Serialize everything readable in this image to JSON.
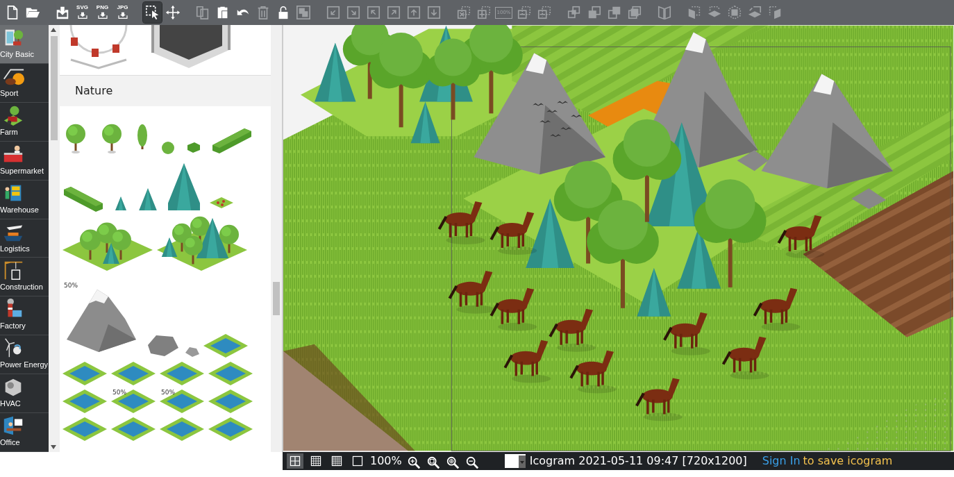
{
  "toolbar": [
    {
      "kind": "new-file",
      "disabled": false,
      "selected": false
    },
    {
      "kind": "open-folder",
      "disabled": false,
      "selected": false
    },
    {
      "kind": "save",
      "disabled": false,
      "selected": false
    },
    {
      "kind": "export",
      "label": "SVG",
      "disabled": false,
      "selected": false
    },
    {
      "kind": "export",
      "label": "PNG",
      "disabled": false,
      "selected": false
    },
    {
      "kind": "export",
      "label": "JPG",
      "disabled": false,
      "selected": false
    },
    {
      "kind": "select",
      "disabled": false,
      "selected": true
    },
    {
      "kind": "move",
      "disabled": false,
      "selected": false
    },
    {
      "kind": "copy",
      "disabled": true,
      "selected": false
    },
    {
      "kind": "paste",
      "disabled": false,
      "selected": false
    },
    {
      "kind": "undo",
      "disabled": false,
      "selected": false
    },
    {
      "kind": "delete",
      "disabled": true,
      "selected": false
    },
    {
      "kind": "lock",
      "disabled": false,
      "selected": false
    },
    {
      "kind": "group",
      "disabled": true,
      "selected": false
    },
    {
      "kind": "arrow-sw",
      "disabled": true,
      "selected": false
    },
    {
      "kind": "arrow-se",
      "disabled": true,
      "selected": false
    },
    {
      "kind": "arrow-nw",
      "disabled": true,
      "selected": false
    },
    {
      "kind": "arrow-ne",
      "disabled": true,
      "selected": false
    },
    {
      "kind": "arrow-up",
      "disabled": true,
      "selected": false
    },
    {
      "kind": "arrow-down",
      "disabled": true,
      "selected": false
    },
    {
      "kind": "dashed-x",
      "disabled": true,
      "selected": false
    },
    {
      "kind": "dashed-plus",
      "disabled": true,
      "selected": false
    },
    {
      "kind": "percent",
      "label": "100%",
      "disabled": true,
      "selected": false
    },
    {
      "kind": "dashed-minus",
      "disabled": true,
      "selected": false
    },
    {
      "kind": "dashed-divide",
      "disabled": true,
      "selected": false
    },
    {
      "kind": "stack-front",
      "disabled": true,
      "selected": false
    },
    {
      "kind": "stack-back",
      "disabled": true,
      "selected": false
    },
    {
      "kind": "stack-forward",
      "disabled": true,
      "selected": false
    },
    {
      "kind": "stack-backward",
      "disabled": true,
      "selected": false
    },
    {
      "kind": "book",
      "disabled": true,
      "selected": false
    },
    {
      "kind": "face-left",
      "disabled": true,
      "selected": false
    },
    {
      "kind": "face-flip",
      "disabled": true,
      "selected": false
    },
    {
      "kind": "cube",
      "disabled": true,
      "selected": false
    },
    {
      "kind": "face-floor",
      "disabled": true,
      "selected": false
    },
    {
      "kind": "face-right",
      "disabled": true,
      "selected": false
    }
  ],
  "categories": [
    {
      "label": "City Basic",
      "kind": "building",
      "selected": true
    },
    {
      "label": "Sport",
      "kind": "ball",
      "selected": false
    },
    {
      "label": "Farm",
      "kind": "tractor",
      "selected": false
    },
    {
      "label": "Supermarket",
      "kind": "counter",
      "selected": false
    },
    {
      "label": "Warehouse",
      "kind": "shelves",
      "selected": false
    },
    {
      "label": "Logistics",
      "kind": "plane",
      "selected": false
    },
    {
      "label": "Construction",
      "kind": "crane",
      "selected": false
    },
    {
      "label": "Factory",
      "kind": "chimney",
      "selected": false
    },
    {
      "label": "Power Energy",
      "kind": "turbine",
      "selected": false
    },
    {
      "label": "HVAC",
      "kind": "aircon",
      "selected": false
    },
    {
      "label": "Office",
      "kind": "desk",
      "selected": false
    }
  ],
  "palette": {
    "previous_items": [
      {
        "kind": "ferris-wheel"
      },
      {
        "kind": "stage"
      }
    ],
    "section_title": "Nature",
    "rows": [
      [
        {
          "kind": "tree"
        },
        {
          "kind": "tree"
        },
        {
          "kind": "column-tree"
        },
        {
          "kind": "bush"
        },
        {
          "kind": "cube-hedge"
        },
        {
          "kind": "long-hedge"
        }
      ],
      [
        {
          "kind": "hedge"
        },
        {
          "kind": "small-pine"
        },
        {
          "kind": "pine"
        },
        {
          "kind": "big-pine"
        },
        {
          "kind": "flowerbed"
        }
      ],
      [
        {
          "kind": "grove"
        },
        {
          "kind": "mixed-grove"
        }
      ],
      [
        {
          "kind": "mountain",
          "label": "50%"
        },
        {
          "kind": "rock"
        },
        {
          "kind": "pebble"
        },
        {
          "kind": "water-tile"
        }
      ],
      [
        {
          "kind": "water-tile"
        },
        {
          "kind": "water-tile"
        },
        {
          "kind": "water-tile"
        },
        {
          "kind": "water-tile"
        }
      ],
      [
        {
          "kind": "water-tile"
        },
        {
          "kind": "water-tile",
          "label": "50%"
        },
        {
          "kind": "water-tile",
          "label": "50%"
        },
        {
          "kind": "water-tile"
        }
      ],
      [
        {
          "kind": "water-tile"
        },
        {
          "kind": "water-tile"
        },
        {
          "kind": "water-tile"
        },
        {
          "kind": "water-tile"
        }
      ]
    ]
  },
  "status_bar": {
    "view_buttons": [
      {
        "kind": "grid",
        "selected": true
      },
      {
        "kind": "grid-dense",
        "selected": false
      },
      {
        "kind": "grid-fine",
        "selected": false
      },
      {
        "kind": "blank",
        "selected": false
      }
    ],
    "zoom": "100%",
    "zoom_buttons": [
      {
        "kind": "zoom-in"
      },
      {
        "kind": "zoom-fit"
      },
      {
        "kind": "zoom-all"
      },
      {
        "kind": "zoom-out"
      }
    ],
    "title": "Icogram 2021-05-11 09:47 [720x1200]",
    "sign_in": "Sign In",
    "sign_in_note": "to save icogram"
  }
}
